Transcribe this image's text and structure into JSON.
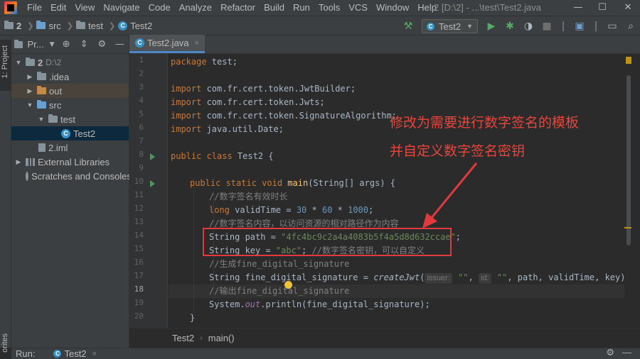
{
  "menu": {
    "items": [
      "File",
      "Edit",
      "View",
      "Navigate",
      "Code",
      "Analyze",
      "Refactor",
      "Build",
      "Run",
      "Tools",
      "VCS",
      "Window",
      "Help"
    ],
    "window_title": "2 [D:\\2] - ...\\test\\Test2.java",
    "minimize": "—",
    "maximize": "☐",
    "close": "✕"
  },
  "navbar": {
    "crumbs": [
      "2",
      "src",
      "test",
      "Test2"
    ],
    "run_config": "Test2",
    "run_config_arrow": "▼"
  },
  "left_stripe": {
    "project_label": "1: Project",
    "favorites_label": "orites"
  },
  "project_panel": {
    "header_label": "Pr...",
    "header_arrow": "▼",
    "tree": [
      {
        "label": "2",
        "suffix": "D:\\2",
        "arrow": "▼"
      },
      {
        "label": ".idea",
        "arrow": "▶"
      },
      {
        "label": "out",
        "arrow": "▶"
      },
      {
        "label": "src",
        "arrow": "▼"
      },
      {
        "label": "test",
        "arrow": "▼"
      },
      {
        "label": "Test2"
      },
      {
        "label": "2.iml"
      },
      {
        "label": "External Libraries",
        "arrow": "▶"
      },
      {
        "label": "Scratches and Consoles"
      }
    ]
  },
  "editor": {
    "tab_label": "Test2.java",
    "tab_close": "×",
    "line_numbers": [
      "1",
      "2",
      "3",
      "4",
      "5",
      "6",
      "7",
      "8",
      "9",
      "10",
      "11",
      "12",
      "13",
      "14",
      "15",
      "16",
      "17",
      "18",
      "19",
      "20"
    ],
    "code": {
      "l1_kw": "package",
      "l1_rest": " test;",
      "l3_kw": "import",
      "l3_rest": " com.fr.cert.token.JwtBuilder;",
      "l4_kw": "import",
      "l4_rest": " com.fr.cert.token.Jwts;",
      "l5_kw": "import",
      "l5_rest": " com.fr.cert.token.SignatureAlgorithm;",
      "l6_kw": "import",
      "l6_rest": " java.util.Date;",
      "l8_kw": "public class",
      "l8_rest": " Test2 {",
      "l10_kw": "public static void",
      "l10_fn": "main",
      "l10_rest": "(String[] args) {",
      "l11_cmt": "//数字签名有效时长",
      "l12_kw": "long",
      "l12_a": " validTime = ",
      "l12_n1": "30",
      "l12_b": " * ",
      "l12_n2": "60",
      "l12_c": " * ",
      "l12_n3": "1000",
      "l12_d": ";",
      "l13_cmt": "//数字签名内容，以访问资源的相对路径作为内容",
      "l14_a": "String path = ",
      "l14_str": "\"4fc4bc9c2a4a4083b5f4a5d8d632ccae\"",
      "l14_b": ";",
      "l15_a": "String key = ",
      "l15_str": "\"abc\"",
      "l15_b": "; ",
      "l15_cmt": "//数字签名密钥，可以自定义",
      "l16_cmt": "//生成fine_digital_signature",
      "l17_a": "String fine_digital_signature = ",
      "l17_fn": "createJwt",
      "l17_b": "(",
      "l17_hint1": "issuer:",
      "l17_s1": " \"\"",
      "l17_c": ", ",
      "l17_hint2": "id:",
      "l17_s2": " \"\"",
      "l17_d": ", path, validTime, key);",
      "l18_cmt": "//输出fine_digital_signature",
      "l19_a": "System.",
      "l19_field": "out",
      "l19_b": ".println(fine_digital_signature);",
      "l20_a": "}"
    },
    "breadcrumb": [
      "Test2",
      "main()"
    ],
    "breadcrumb_sep": "›"
  },
  "bottom": {
    "run_label": "Run:",
    "run_tab": "Test2",
    "run_tab_close": "×"
  },
  "annotation": {
    "line1": "修改为需要进行数字签名的模板",
    "line2": "并自定义数字签名密钥",
    "color": "#e03a3e"
  }
}
